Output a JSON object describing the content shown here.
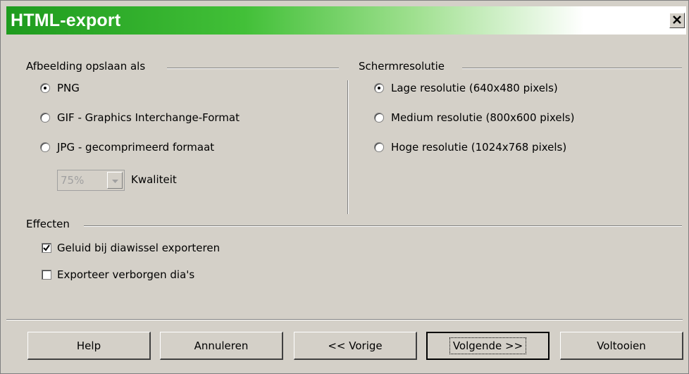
{
  "window": {
    "title": "HTML-export",
    "close_label": "x"
  },
  "image_group": {
    "label": "Afbeelding opslaan als",
    "options": [
      {
        "label": "PNG",
        "selected": true
      },
      {
        "label": "GIF - Graphics Interchange-Format",
        "selected": false
      },
      {
        "label": "JPG - gecomprimeerd formaat",
        "selected": false
      }
    ],
    "quality": {
      "value": "75%",
      "label": "Kwaliteit"
    }
  },
  "resolution_group": {
    "label": "Schermresolutie",
    "options": [
      {
        "label": "Lage resolutie (640x480 pixels)",
        "selected": true
      },
      {
        "label": "Medium resolutie (800x600 pixels)",
        "selected": false
      },
      {
        "label": "Hoge resolutie (1024x768 pixels)",
        "selected": false
      }
    ]
  },
  "effects_group": {
    "label": "Effecten",
    "checks": [
      {
        "label": "Geluid bij diawissel exporteren",
        "checked": true
      },
      {
        "label": "Exporteer verborgen dia's",
        "checked": false
      }
    ]
  },
  "buttons": {
    "help": "Help",
    "cancel": "Annuleren",
    "back": "<< Vorige",
    "next": "Volgende >>",
    "finish": "Voltooien"
  },
  "colors": {
    "titlebar_start": "#1e9b1e",
    "dialog_bg": "#d4d0c8"
  }
}
